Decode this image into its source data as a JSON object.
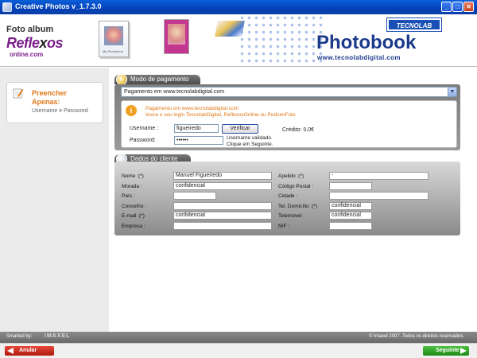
{
  "window": {
    "title": "Creative Photos v_1.7.3.0",
    "min": "_",
    "max": "□",
    "close": "✕"
  },
  "banner": {
    "foto_album": "Foto album",
    "reflexos": "Refle",
    "reflexos_x": "x",
    "reflexos_end": "os",
    "online": "online.com",
    "thumb_caption": "My Photobook",
    "tecnolab": "TECNOLAB",
    "photobook": "Photobook",
    "url": "www.tecnolabdigital.com"
  },
  "sidebar": {
    "step_title": "Preencher Apenas:",
    "step_desc": "Username e Password"
  },
  "payment": {
    "header": "Modo de pagamento",
    "selected_method": "Pagamento em www.tecnolabdigital.com",
    "info_url": "Pagamento em www.tecnolabdigital.com",
    "info_text": "Insira o seu login TecnolabDigital,  ReflexosOnline ou PodiumFoto.",
    "username_label": "Username :",
    "username_value": "figueiredo",
    "password_label": "Password:",
    "password_value": "••••••",
    "verify_button": "Verificar",
    "credit": "Crédito: 0,0€",
    "validated_1": "Username validado.",
    "validated_2": "Clique em Seguinte."
  },
  "client": {
    "header": "Dados do cliente",
    "nome_label": "Nome :(*)",
    "nome_value": "Manuel Figueiredo",
    "apelido_label": "Apelido :(*)",
    "apelido_value": "-",
    "morada_label": "Morada :",
    "morada_value": "confidencial",
    "codigo_label": "Código Postal :",
    "codigo_value": "",
    "pais_label": "País :",
    "pais_value": "",
    "cidade_label": "Cidade :",
    "cidade_value": "",
    "concelho_label": "Concelho :",
    "concelho_value": "",
    "tel_label": "Tel. Domicílio :(*)",
    "tel_value": "confidencial",
    "email_label": "E-mail :(*)",
    "email_value": "confidencial",
    "telemovel_label": "Telemóvel :",
    "telemovel_value": "confidencial",
    "empresa_label": "Empresa :",
    "empresa_value": "",
    "nif_label": "NIF :",
    "nif_value": ""
  },
  "footer": {
    "smarted": "Smarted by:",
    "imaxel": "IMAXEL",
    "copyright": "© Imaxel 2007. Todos os direitos reservados."
  },
  "nav": {
    "cancel": "Anular",
    "next": "Seguinte"
  }
}
